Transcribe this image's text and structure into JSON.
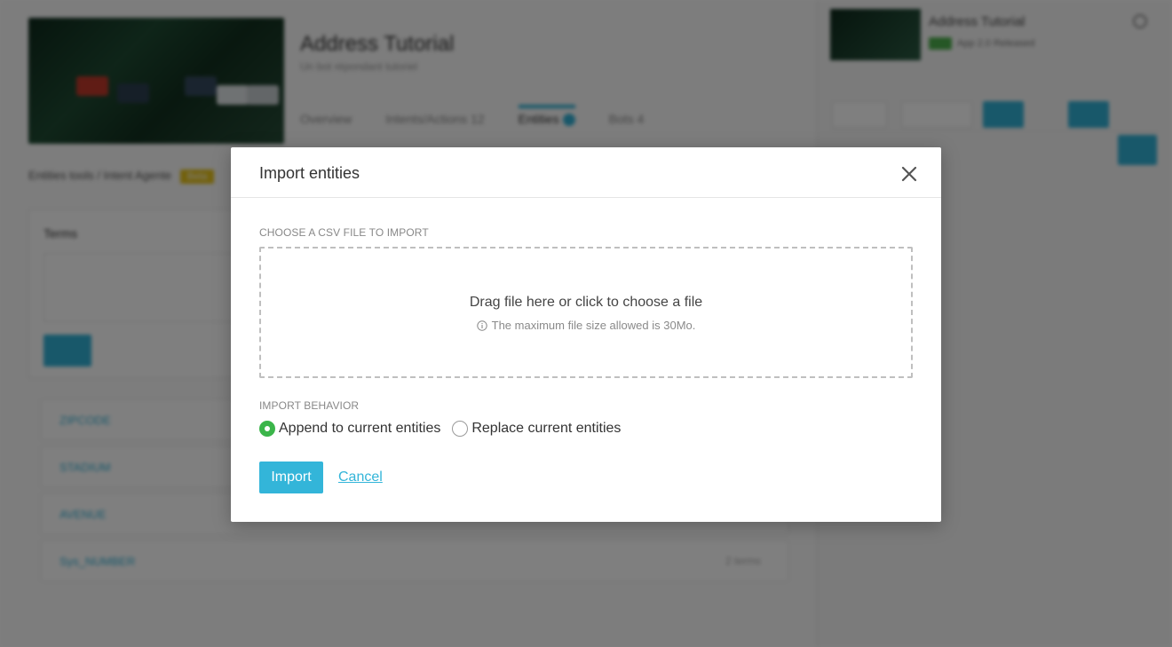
{
  "background": {
    "bot": {
      "title": "Address Tutorial",
      "subtitle": "Un bot répondant tutoriel",
      "tabs": [
        "Overview",
        "Intents/Actions 12",
        "Entities",
        "Bots 4"
      ],
      "breadcrumb": "Entities tools / Intent Agente",
      "breadcrumb_tag": "Beta",
      "terms_title": "Terms",
      "list_items": [
        "ZIPCODE",
        "STADIUM",
        "AVENUE",
        "Sys_NUMBER"
      ],
      "list_meta": "2 terms"
    },
    "emulator": {
      "title": "Address Tutorial",
      "status": "App 2.0 Released"
    }
  },
  "modal": {
    "title": "Import entities",
    "file_section_label": "CHOOSE A CSV FILE TO IMPORT",
    "dropzone_text": "Drag file here or click to choose a file",
    "dropzone_hint": "The maximum file size allowed is 30Mo.",
    "behavior_label": "IMPORT BEHAVIOR",
    "options": [
      {
        "label": "Append to current entities",
        "checked": true
      },
      {
        "label": "Replace current entities",
        "checked": false
      }
    ],
    "import_label": "Import",
    "cancel_label": "Cancel"
  },
  "colors": {
    "accent": "#33b5d9",
    "radio_checked": "#3bb54a",
    "overlay": "rgba(0,0,0,0.5)"
  },
  "icons": {
    "close": "close-icon",
    "info": "info-icon"
  }
}
